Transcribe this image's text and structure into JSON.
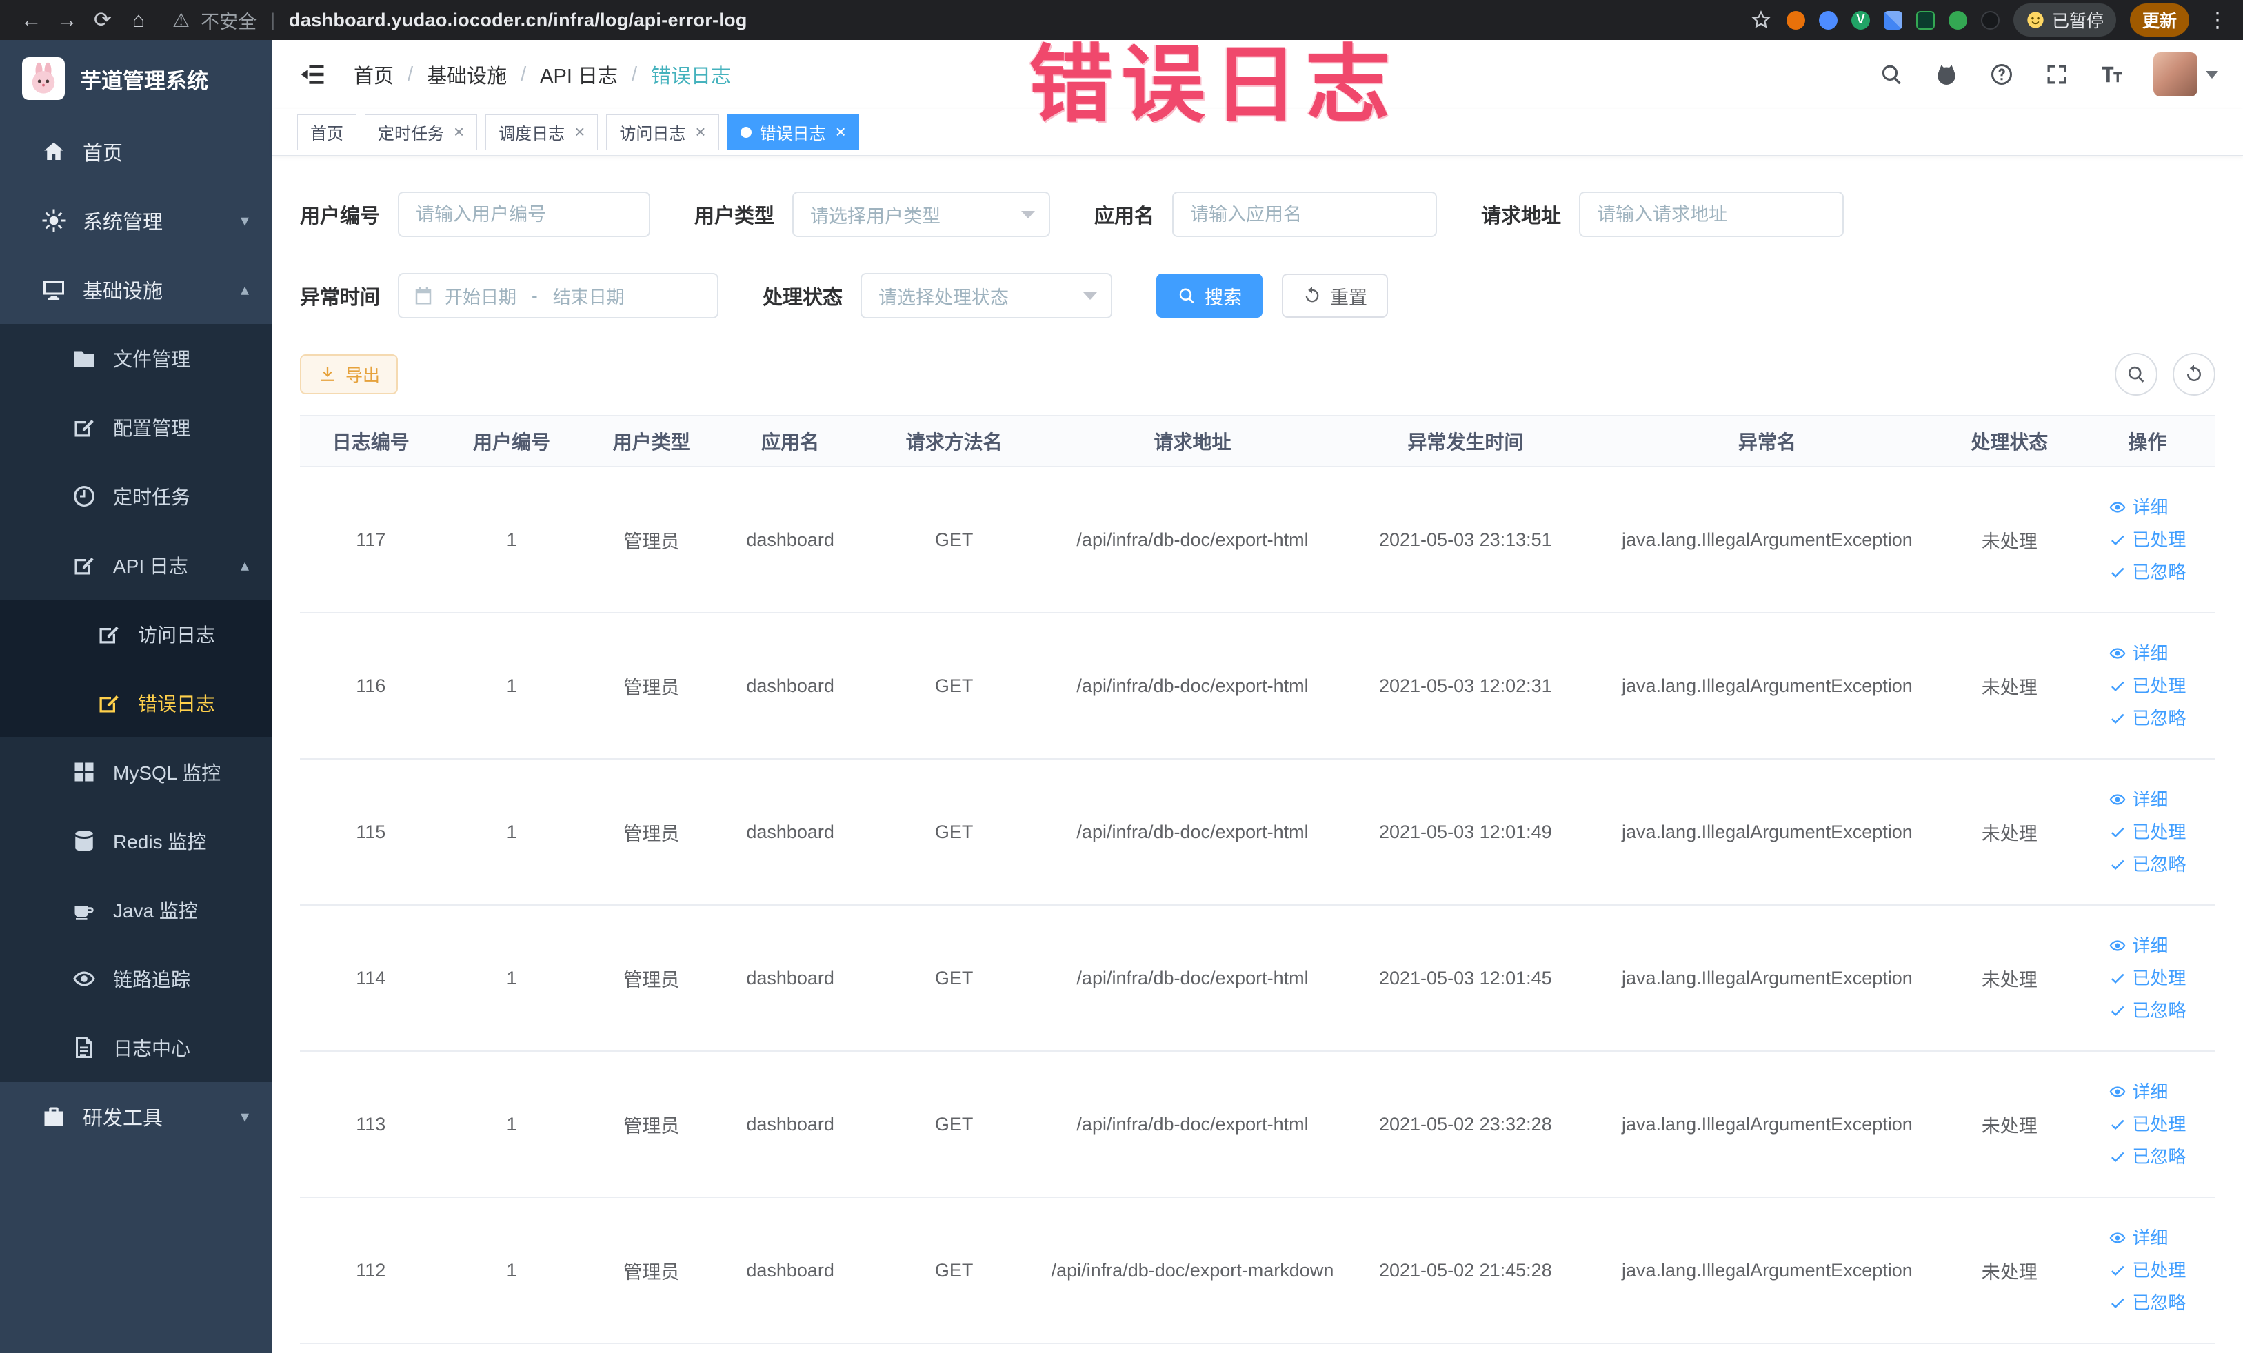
{
  "browser": {
    "security_label": "不安全",
    "url": "dashboard.yudao.iocoder.cn/infra/log/api-error-log",
    "paused_label": "已暂停",
    "update_label": "更新",
    "nav_icons": [
      "back-icon",
      "forward-icon",
      "reload-icon",
      "home-icon"
    ],
    "extension_icons": [
      "star-icon",
      "extension-orange-icon",
      "extension-drop-icon",
      "extension-green-icon",
      "extension-grid-icon",
      "extension-on-icon",
      "extension-leaf-icon",
      "extension-paw-icon",
      "smiley-icon"
    ]
  },
  "annotation": {
    "text": "错误日志",
    "color": "#f0486c"
  },
  "colors": {
    "accent": "#409eff",
    "sidebar_bg": "#304156",
    "submenu_bg": "#1f2d3d",
    "active_menu_text": "#ffd04b",
    "warning": "#e6a23c",
    "annotation": "#f0486c",
    "breadcrumb_current": "#45b2bd"
  },
  "sidebar": {
    "title": "芋道管理系统",
    "items": [
      {
        "id": "home",
        "label": "首页",
        "icon": "home-icon",
        "shape": "home",
        "depth": 0
      },
      {
        "id": "system",
        "label": "系统管理",
        "icon": "gear-icon",
        "shape": "gear",
        "depth": 0,
        "chevron": "down"
      },
      {
        "id": "infra",
        "label": "基础设施",
        "icon": "monitor-icon",
        "shape": "monitor",
        "depth": 0,
        "chevron": "up"
      },
      {
        "id": "file",
        "label": "文件管理",
        "icon": "folder-icon",
        "shape": "folder",
        "depth": 1
      },
      {
        "id": "config",
        "label": "配置管理",
        "icon": "edit-icon",
        "shape": "edit",
        "depth": 1
      },
      {
        "id": "job",
        "label": "定时任务",
        "icon": "clock-icon",
        "shape": "clock",
        "depth": 1
      },
      {
        "id": "api-log",
        "label": "API 日志",
        "icon": "document-icon",
        "shape": "edit",
        "depth": 1,
        "chevron": "up"
      },
      {
        "id": "access-log",
        "label": "访问日志",
        "icon": "document-icon",
        "shape": "edit",
        "depth": 2
      },
      {
        "id": "error-log",
        "label": "错误日志",
        "icon": "document-icon",
        "shape": "edit",
        "depth": 2,
        "active": true
      },
      {
        "id": "mysql",
        "label": "MySQL 监控",
        "icon": "grid-icon",
        "shape": "grid",
        "depth": 1
      },
      {
        "id": "redis",
        "label": "Redis 监控",
        "icon": "database-icon",
        "shape": "db",
        "depth": 1
      },
      {
        "id": "java",
        "label": "Java 监控",
        "icon": "coffee-icon",
        "shape": "coffee",
        "depth": 1
      },
      {
        "id": "trace",
        "label": "链路追踪",
        "icon": "eye-icon",
        "shape": "eye",
        "depth": 1
      },
      {
        "id": "log-center",
        "label": "日志中心",
        "icon": "document-icon",
        "shape": "doc",
        "depth": 1
      },
      {
        "id": "devtools",
        "label": "研发工具",
        "icon": "briefcase-icon",
        "shape": "briefcase",
        "depth": 0,
        "chevron": "down"
      }
    ]
  },
  "breadcrumb": [
    "首页",
    "基础设施",
    "API 日志",
    "错误日志"
  ],
  "tabs": [
    {
      "id": "home",
      "label": "首页",
      "closable": false,
      "active": false
    },
    {
      "id": "job",
      "label": "定时任务",
      "closable": true,
      "active": false
    },
    {
      "id": "job-log",
      "label": "调度日志",
      "closable": true,
      "active": false
    },
    {
      "id": "access-log",
      "label": "访问日志",
      "closable": true,
      "active": false
    },
    {
      "id": "error-log",
      "label": "错误日志",
      "closable": true,
      "active": true
    }
  ],
  "filters": {
    "user_id": {
      "label": "用户编号",
      "placeholder": "请输入用户编号"
    },
    "user_type": {
      "label": "用户类型",
      "placeholder": "请选择用户类型"
    },
    "app_name": {
      "label": "应用名",
      "placeholder": "请输入应用名"
    },
    "request_url": {
      "label": "请求地址",
      "placeholder": "请输入请求地址"
    },
    "exception_time": {
      "label": "异常时间",
      "start_placeholder": "开始日期",
      "separator": "-",
      "end_placeholder": "结束日期"
    },
    "process_status": {
      "label": "处理状态",
      "placeholder": "请选择处理状态"
    },
    "search_label": "搜索",
    "reset_label": "重置"
  },
  "toolbar": {
    "export_label": "导出"
  },
  "table": {
    "headers": [
      "日志编号",
      "用户编号",
      "用户类型",
      "应用名",
      "请求方法名",
      "请求地址",
      "异常发生时间",
      "异常名",
      "处理状态",
      "操作"
    ],
    "rows": [
      [
        "117",
        "1",
        "管理员",
        "dashboard",
        "GET",
        "/api/infra/db-doc/export-html",
        "2021-05-03 23:13:51",
        "java.lang.IllegalArgumentException",
        "未处理"
      ],
      [
        "116",
        "1",
        "管理员",
        "dashboard",
        "GET",
        "/api/infra/db-doc/export-html",
        "2021-05-03 12:02:31",
        "java.lang.IllegalArgumentException",
        "未处理"
      ],
      [
        "115",
        "1",
        "管理员",
        "dashboard",
        "GET",
        "/api/infra/db-doc/export-html",
        "2021-05-03 12:01:49",
        "java.lang.IllegalArgumentException",
        "未处理"
      ],
      [
        "114",
        "1",
        "管理员",
        "dashboard",
        "GET",
        "/api/infra/db-doc/export-html",
        "2021-05-03 12:01:45",
        "java.lang.IllegalArgumentException",
        "未处理"
      ],
      [
        "113",
        "1",
        "管理员",
        "dashboard",
        "GET",
        "/api/infra/db-doc/export-html",
        "2021-05-02 23:32:28",
        "java.lang.IllegalArgumentException",
        "未处理"
      ],
      [
        "112",
        "1",
        "管理员",
        "dashboard",
        "GET",
        "/api/infra/db-doc/export-markdown",
        "2021-05-02 21:45:28",
        "java.lang.IllegalArgumentException",
        "未处理"
      ]
    ],
    "actions": [
      {
        "id": "detail",
        "label": "详细",
        "icon": "eye-icon",
        "shape": "eye"
      },
      {
        "id": "processed",
        "label": "已处理",
        "icon": "check-icon",
        "shape": "check"
      },
      {
        "id": "ignored",
        "label": "已忽略",
        "icon": "check-icon",
        "shape": "check"
      }
    ]
  }
}
